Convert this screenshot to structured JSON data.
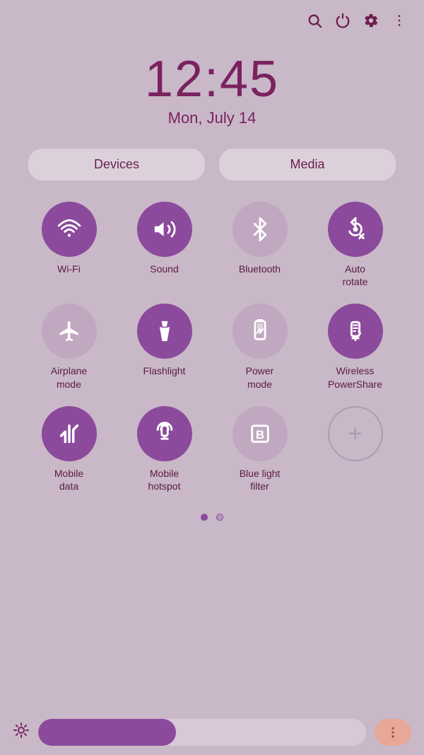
{
  "topbar": {
    "search_label": "search",
    "power_label": "power",
    "settings_label": "settings",
    "more_label": "more"
  },
  "clock": {
    "time": "12:45",
    "date": "Mon, July 14"
  },
  "device_media": {
    "devices_label": "Devices",
    "media_label": "Media"
  },
  "toggles": [
    {
      "id": "wifi",
      "label": "Wi-Fi",
      "active": true
    },
    {
      "id": "sound",
      "label": "Sound",
      "active": true
    },
    {
      "id": "bluetooth",
      "label": "Bluetooth",
      "active": false
    },
    {
      "id": "auto-rotate",
      "label": "Auto\nrotate",
      "active": true
    },
    {
      "id": "airplane-mode",
      "label": "Airplane\nmode",
      "active": false
    },
    {
      "id": "flashlight",
      "label": "Flashlight",
      "active": true
    },
    {
      "id": "power-mode",
      "label": "Power\nmode",
      "active": false
    },
    {
      "id": "wireless-powershare",
      "label": "Wireless\nPowerShare",
      "active": true
    },
    {
      "id": "mobile-data",
      "label": "Mobile\ndata",
      "active": true
    },
    {
      "id": "mobile-hotspot",
      "label": "Mobile\nhotspot",
      "active": true
    },
    {
      "id": "blue-light-filter",
      "label": "Blue light\nfilter",
      "active": false
    },
    {
      "id": "add",
      "label": "",
      "active": false
    }
  ],
  "page_dots": [
    {
      "active": true
    },
    {
      "active": false
    }
  ],
  "brightness": {
    "fill_percent": 42
  }
}
